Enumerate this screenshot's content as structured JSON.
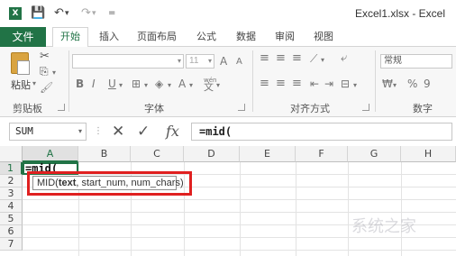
{
  "titlebar": {
    "logo_text": "X",
    "save_icon": "💾",
    "undo_icon": "↶",
    "redo_icon": "↷",
    "customize_icon": "=",
    "title": "Excel1.xlsx - Excel"
  },
  "tabs": {
    "file": "文件",
    "items": [
      "开始",
      "插入",
      "页面布局",
      "公式",
      "数据",
      "审阅",
      "视图"
    ]
  },
  "ribbon": {
    "clipboard": {
      "paste_label": "粘贴",
      "group_label": "剪贴板"
    },
    "font": {
      "font_size": "11",
      "bold": "B",
      "italic": "I",
      "underline": "U",
      "grow": "A",
      "shrink": "A",
      "color_a": "A",
      "wen": "wén",
      "group_label": "字体"
    },
    "alignment": {
      "group_label": "对齐方式"
    },
    "number": {
      "format": "常规",
      "percent": "%",
      "comma": "9",
      "group_label": "数字"
    }
  },
  "formula_bar": {
    "name_box": "SUM",
    "cancel_icon": "✕",
    "enter_icon": "✓",
    "fx_label": "fx",
    "formula": "=mid("
  },
  "grid": {
    "columns": [
      "A",
      "B",
      "C",
      "D",
      "E",
      "F",
      "G",
      "H"
    ],
    "rows": [
      "1",
      "2",
      "3",
      "4",
      "5",
      "6",
      "7"
    ],
    "a1_value": "=mid("
  },
  "tooltip": {
    "func": "MID(",
    "arg_bold": "text",
    "rest": ", start_num, num_chars)"
  },
  "watermark": "系统之家",
  "colors": {
    "excel_green": "#217346",
    "highlight_red": "#e02020"
  }
}
